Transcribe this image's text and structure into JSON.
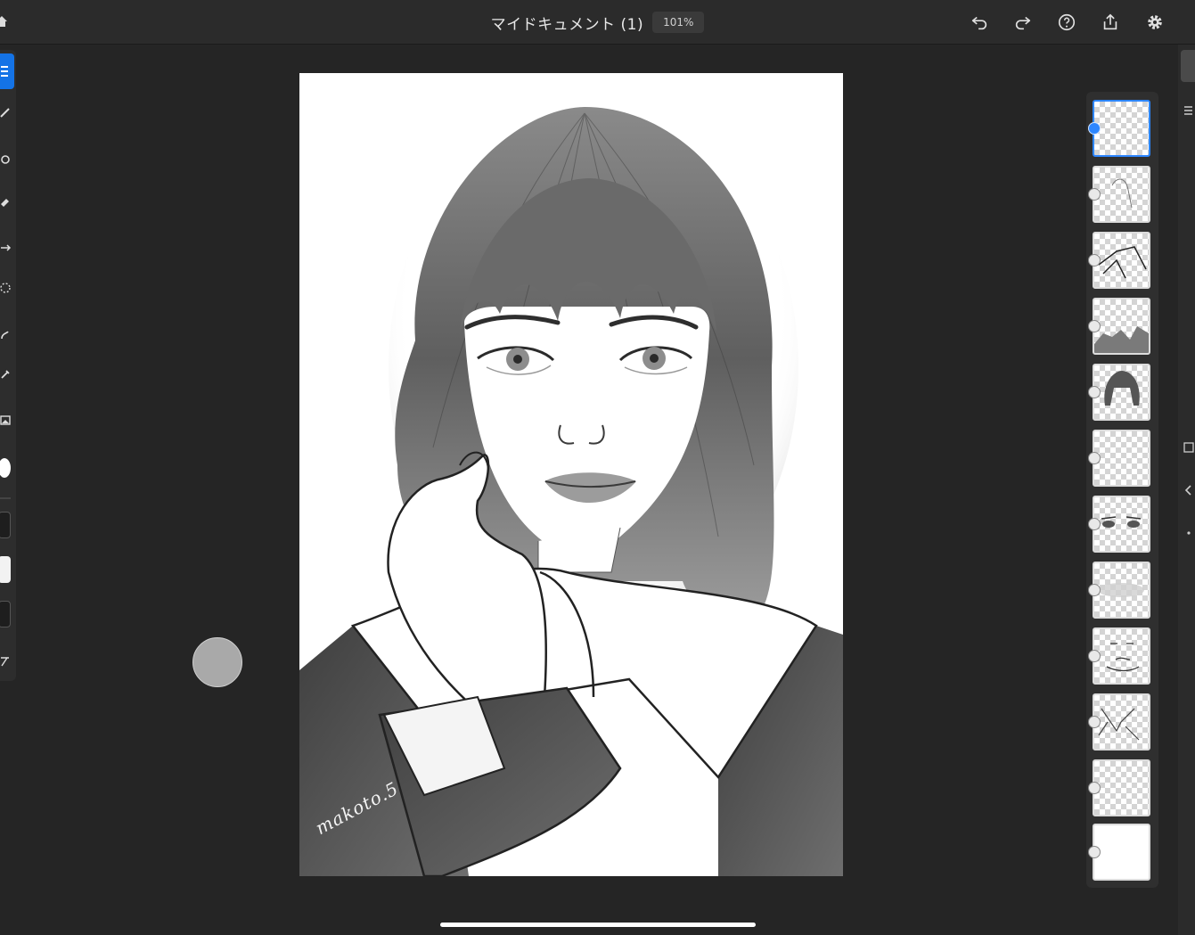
{
  "header": {
    "document_title": "マイドキュメント (1)",
    "zoom_level": "101%"
  },
  "icons": {
    "home": "home-icon",
    "undo": "undo-icon",
    "redo": "redo-icon",
    "help": "help-icon",
    "share": "share-icon",
    "settings": "gear-icon"
  },
  "toolbar": {
    "tools": [
      "layer-tool",
      "brush-tool",
      "fill-tool",
      "eraser-tool",
      "transform-tool",
      "selection-tool",
      "smudge-tool",
      "eyedropper-tool",
      "image-tool"
    ],
    "primary_color": "#ffffff",
    "secondary_color": "#1e1e1e"
  },
  "artwork": {
    "signature": "makoto.5"
  },
  "layers": [
    {
      "thumb": "blank",
      "selected": true
    },
    {
      "thumb": "hand-sketch",
      "selected": false
    },
    {
      "thumb": "collar-lines",
      "selected": false
    },
    {
      "thumb": "shoulder-shading",
      "selected": false
    },
    {
      "thumb": "hair",
      "selected": false
    },
    {
      "thumb": "blank",
      "selected": false
    },
    {
      "thumb": "eyes",
      "selected": false
    },
    {
      "thumb": "blush",
      "selected": false
    },
    {
      "thumb": "face-features",
      "selected": false
    },
    {
      "thumb": "outline",
      "selected": false
    },
    {
      "thumb": "blank",
      "selected": false
    },
    {
      "thumb": "background-white",
      "selected": false
    }
  ],
  "colors": {
    "accent": "#1473e6",
    "selected_layer": "#2d86ff",
    "app_background": "#252525"
  }
}
